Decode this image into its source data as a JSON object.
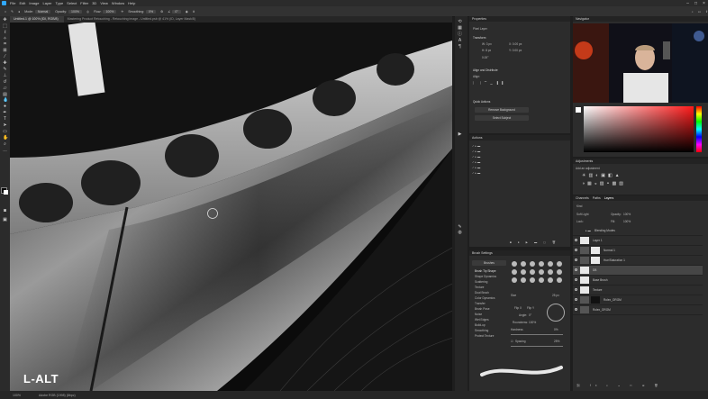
{
  "menubar": {
    "items": [
      "File",
      "Edit",
      "Image",
      "Layer",
      "Type",
      "Select",
      "Filter",
      "3D",
      "View",
      "Window",
      "Help"
    ]
  },
  "optbar": {
    "mode_label": "Mode:",
    "mode_value": "Normal",
    "opacity_label": "Opacity:",
    "opacity_value": "100%",
    "flow_label": "Flow:",
    "flow_value": "100%",
    "smoothing_label": "Smoothing:",
    "smoothing_value": "0%",
    "angle_value": "0°"
  },
  "tabs": [
    "Untitled-1 @ 100% (IDI, RGB/8)",
    "Mastering Product Retouching - Retouching image - Untitled.psb @ 41% (ID, Layer Mask/8)"
  ],
  "canvas": {
    "overlay_text": "L-ALT"
  },
  "status": {
    "zoom": "100%",
    "doc_info": "Adobe RGB (1998) (8bpc)"
  },
  "properties": {
    "title": "Properties",
    "pixel_layer": "Pixel Layer",
    "transform_label": "Transform",
    "w": "W: 3 px",
    "h": "H: 8 px",
    "x": "X: 0.00 px",
    "y": "Y: 0.00 px",
    "angle": "0.00°",
    "align_label": "Align and Distribute",
    "align_sub": "Align:",
    "quick_actions": "Quick Actions",
    "remove_bg": "Remove Background",
    "select_subject": "Select Subject"
  },
  "actions": {
    "title": "Actions",
    "sets": [
      "",
      "",
      "",
      "",
      "",
      ""
    ]
  },
  "brush_settings": {
    "title": "Brush Settings",
    "brushes_btn": "Brushes",
    "options": [
      "Brush Tip Shape",
      "Shape Dynamics",
      "Scattering",
      "Texture",
      "Dual Brush",
      "Color Dynamics",
      "Transfer",
      "Brush Pose",
      "Noise",
      "Wet Edges",
      "Build-up",
      "Smoothing",
      "Protect Texture"
    ],
    "size_label": "Size",
    "size_value": "25 px",
    "flip_x": "Flip X",
    "flip_y": "Flip Y",
    "angle_label": "Angle:",
    "angle_value": "0°",
    "roundness_label": "Roundness:",
    "roundness_value": "100%",
    "hardness_label": "Hardness",
    "hardness_value": "0%",
    "spacing_label": "Spacing",
    "spacing_value": "25%"
  },
  "navigator": {
    "title": "Navigator"
  },
  "adjustments": {
    "title": "Adjustments",
    "subtitle": "Add an adjustment"
  },
  "layers": {
    "tabs": [
      "Channels",
      "Paths",
      "Layers"
    ],
    "kind_label": "Kind",
    "blend_mode": "Soft Light",
    "opacity_label": "Opacity:",
    "opacity_value": "100%",
    "lock_label": "Lock:",
    "fill_label": "Fill:",
    "fill_value": "100%",
    "items": [
      {
        "name": "Blending Modes"
      },
      {
        "name": "Layer 1"
      },
      {
        "name": "Normal 1"
      },
      {
        "name": "Hue/Saturation 1"
      },
      {
        "name": "DB"
      },
      {
        "name": "Base Brush"
      },
      {
        "name": "Texture"
      },
      {
        "name": "Rolex_ORGM"
      },
      {
        "name": "Rolex_ORGM"
      }
    ]
  },
  "colors": {
    "accent": "#31a8ff",
    "panel": "#2c2c2c"
  }
}
